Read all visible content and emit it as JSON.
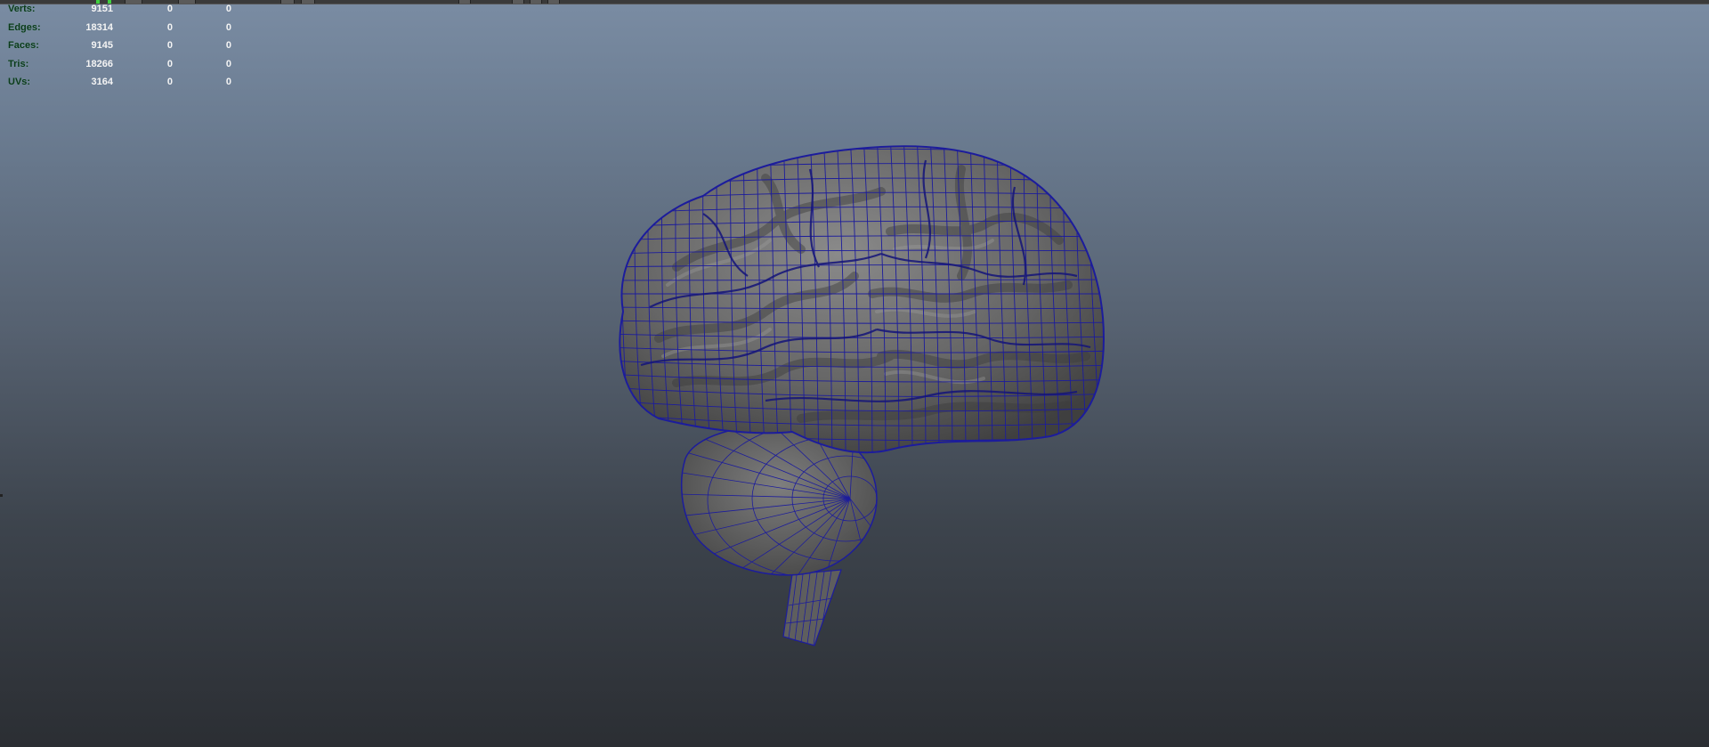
{
  "hud": {
    "rows": [
      {
        "label": "Verts:",
        "total": "9151",
        "selected": "0",
        "component": "0"
      },
      {
        "label": "Edges:",
        "total": "18314",
        "selected": "0",
        "component": "0"
      },
      {
        "label": "Faces:",
        "total": "9145",
        "selected": "0",
        "component": "0"
      },
      {
        "label": "Tris:",
        "total": "18266",
        "selected": "0",
        "component": "0"
      },
      {
        "label": "UVs:",
        "total": "3164",
        "selected": "0",
        "component": "0"
      }
    ]
  },
  "colors": {
    "hud_label": "#0a3a1a",
    "hud_value": "#f4f4f4",
    "wireframe": "#1c1c9c",
    "mesh_shade": "#6b6b6b",
    "background_top": "#7a8ca3",
    "background_bottom": "#2b2e33"
  },
  "viewport": {
    "object_icon": "brain-mesh-icon",
    "display_mode": "wireframe-on-shaded"
  }
}
